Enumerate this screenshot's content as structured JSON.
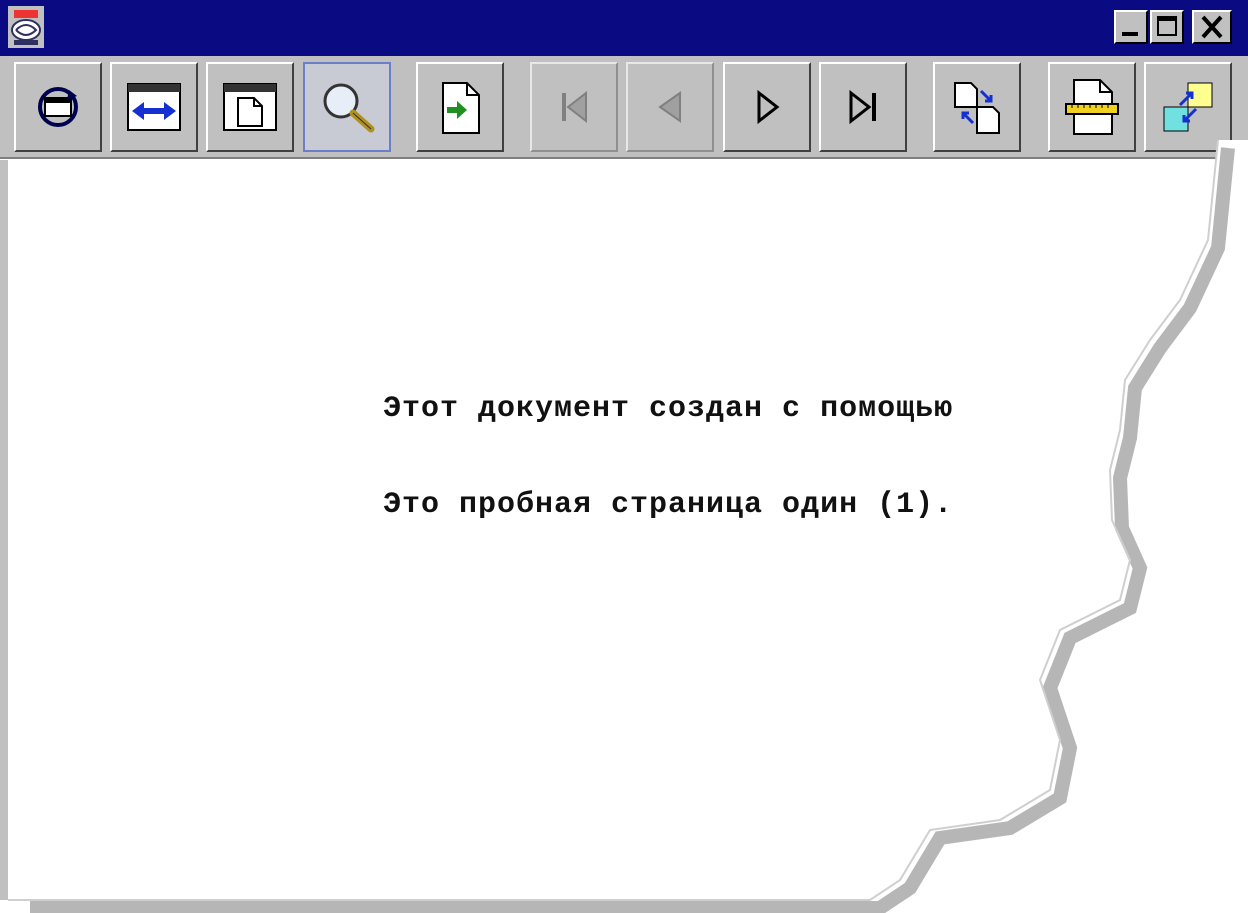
{
  "window": {
    "title": "",
    "controls": [
      "minimize",
      "maximize",
      "close"
    ]
  },
  "toolbar": {
    "buttons": [
      {
        "name": "refresh",
        "icon": "rotate-window-icon",
        "state": "normal"
      },
      {
        "name": "fit-width",
        "icon": "fit-width-icon",
        "state": "normal"
      },
      {
        "name": "fit-page",
        "icon": "fit-page-icon",
        "state": "normal"
      },
      {
        "name": "zoom",
        "icon": "magnifier-icon",
        "state": "pressed"
      },
      {
        "name": "go-to-page",
        "icon": "go-to-page-icon",
        "state": "normal"
      },
      {
        "name": "first-page",
        "icon": "first-page-icon",
        "state": "disabled"
      },
      {
        "name": "previous-page",
        "icon": "previous-page-icon",
        "state": "disabled"
      },
      {
        "name": "next-page",
        "icon": "next-page-icon",
        "state": "normal"
      },
      {
        "name": "last-page",
        "icon": "last-page-icon",
        "state": "normal"
      },
      {
        "name": "compare-pages",
        "icon": "compare-pages-icon",
        "state": "normal"
      },
      {
        "name": "ruler",
        "icon": "ruler-icon",
        "state": "normal"
      },
      {
        "name": "swap-colors",
        "icon": "swap-colors-icon",
        "state": "normal"
      }
    ]
  },
  "document": {
    "lines": [
      "Этот документ создан с помощью",
      "Это пробная страница один (1)."
    ]
  },
  "colors": {
    "titlebar": "#0a0a82",
    "toolbar": "#c0c0c0",
    "page": "#ffffff"
  }
}
